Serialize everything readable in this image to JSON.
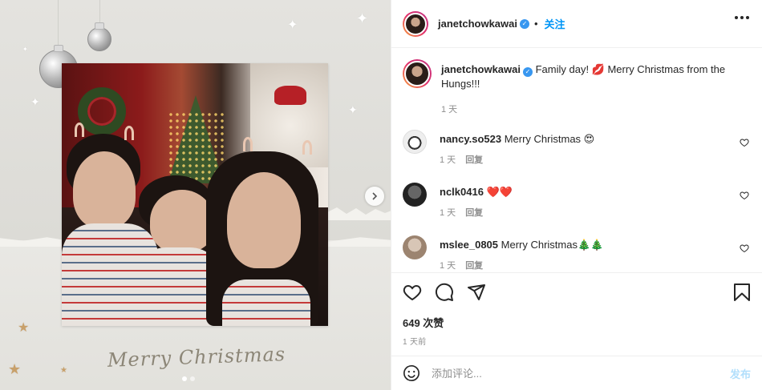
{
  "post": {
    "username": "janetchowkawai",
    "follow_label": "关注",
    "caption_text": "Family day! 💋 Merry Christmas from the Hungs!!!",
    "caption_time": "1 天",
    "image_caption": "Merry Christmas",
    "likes": "649 次赞",
    "posted_ago": "1 天前"
  },
  "comments": [
    {
      "username": "nancy.so523",
      "text": "Merry Christmas 😍",
      "time": "1 天",
      "reply_label": "回复"
    },
    {
      "username": "nclk0416",
      "text": "❤️❤️",
      "time": "1 天",
      "reply_label": "回复"
    },
    {
      "username": "mslee_0805",
      "text": "Merry Christmas🎄🎄",
      "time": "1 天",
      "reply_label": "回复"
    }
  ],
  "add_comment": {
    "placeholder": "添加评论...",
    "post_label": "发布"
  },
  "icons": {
    "like": "heart-icon",
    "comment": "comment-icon",
    "share": "share-icon",
    "save": "bookmark-icon",
    "emoji": "emoji-icon",
    "more": "more-icon",
    "next": "chevron-right-icon"
  },
  "colors": {
    "accent": "#0095f6",
    "post_disabled": "#b2dffc",
    "muted": "#8e8e8e",
    "text": "#262626"
  }
}
